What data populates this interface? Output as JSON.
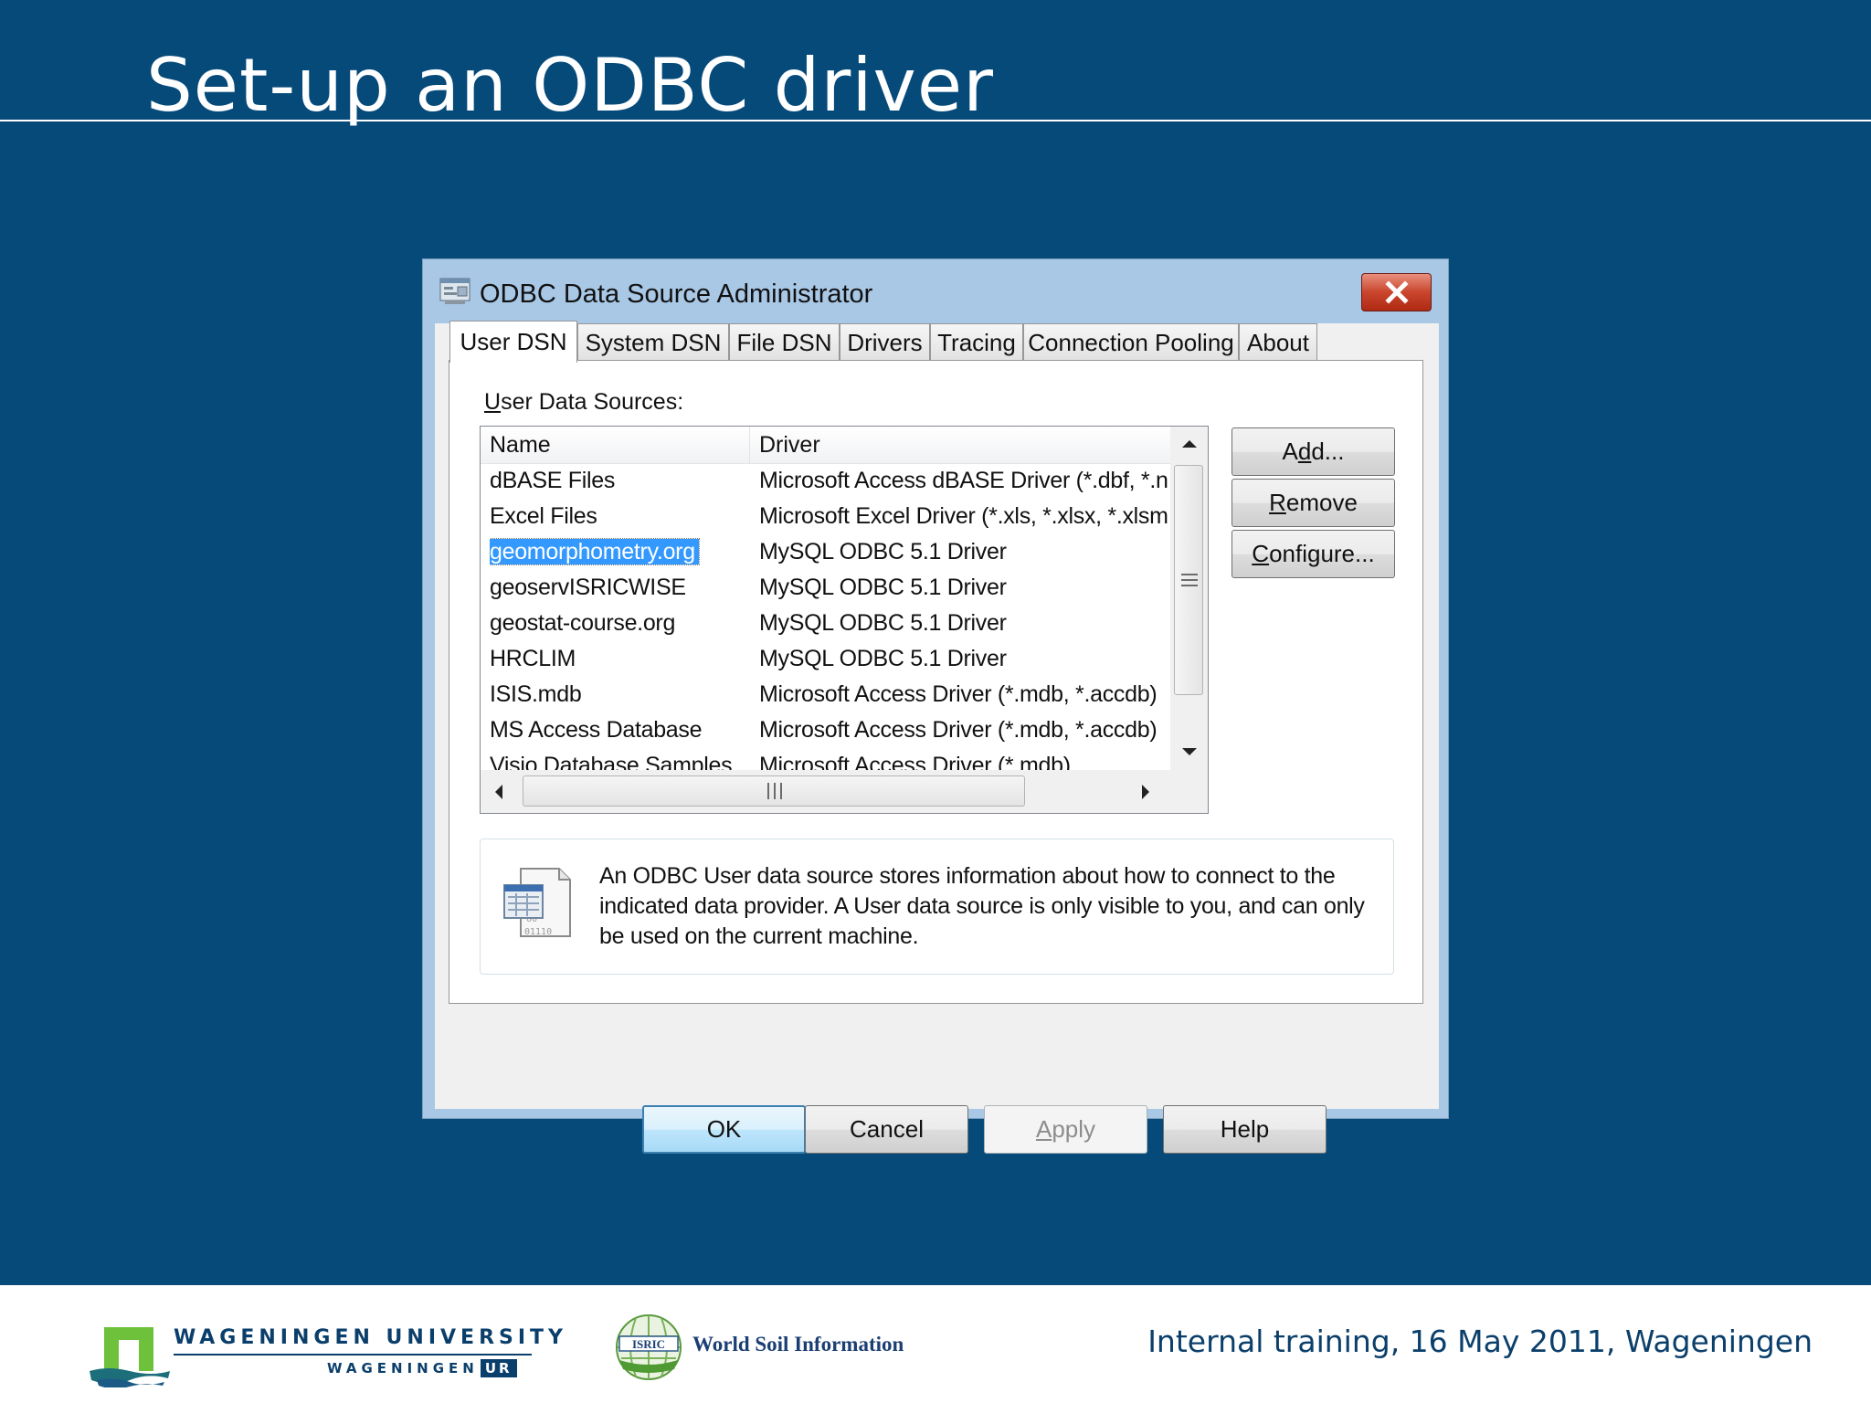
{
  "slide": {
    "title": "Set-up an ODBC driver"
  },
  "dialog": {
    "title": "ODBC Data Source Administrator",
    "tabs": [
      {
        "label": "User DSN",
        "active": true
      },
      {
        "label": "System DSN"
      },
      {
        "label": "File DSN"
      },
      {
        "label": "Drivers"
      },
      {
        "label": "Tracing"
      },
      {
        "label": "Connection Pooling"
      },
      {
        "label": "About"
      }
    ],
    "section_label_prefix": "U",
    "section_label_rest": "ser Data Sources:",
    "columns": {
      "name": "Name",
      "driver": "Driver"
    },
    "rows": [
      {
        "name": "dBASE Files",
        "driver": "Microsoft Access dBASE Driver (*.dbf, *.ndx, *.mdx)"
      },
      {
        "name": "Excel Files",
        "driver": "Microsoft Excel Driver (*.xls, *.xlsx, *.xlsm, *.xlsb)"
      },
      {
        "name": "geomorphometry.org",
        "driver": "MySQL ODBC 5.1 Driver",
        "selected": true
      },
      {
        "name": "geoservISRICWISE",
        "driver": "MySQL ODBC 5.1 Driver"
      },
      {
        "name": "geostat-course.org",
        "driver": "MySQL ODBC 5.1 Driver"
      },
      {
        "name": "HRCLIM",
        "driver": "MySQL ODBC 5.1 Driver"
      },
      {
        "name": "ISIS.mdb",
        "driver": "Microsoft Access Driver (*.mdb, *.accdb)"
      },
      {
        "name": "MS Access Database",
        "driver": "Microsoft Access Driver (*.mdb, *.accdb)"
      },
      {
        "name": "Visio Database Samples",
        "driver": "Microsoft Access Driver (*.mdb)"
      }
    ],
    "side_buttons": {
      "add_pre": "A",
      "add_ul": "d",
      "add_post": "d...",
      "remove_ul": "R",
      "remove_post": "emove",
      "configure_ul": "C",
      "configure_post": "onfigure..."
    },
    "info_text": "An ODBC User data source stores information about how to connect to the indicated data provider.   A User data source is only visible to you, and can only be used on the current machine.",
    "info_icon_caption": "01110",
    "bottom_buttons": {
      "ok": "OK",
      "cancel": "Cancel",
      "apply_ul": "A",
      "apply_post": "pply",
      "help": "Help"
    }
  },
  "footer": {
    "wur_name": "WAGENINGEN UNIVERSITY",
    "wur_sub": "WAGENINGEN",
    "wur_ur": "UR",
    "isric_logo_text": "ISRIC",
    "isric_text": "World Soil Information",
    "info": "Internal training, 16 May 2011, Wageningen"
  },
  "colors": {
    "slide_background": "#064a7a",
    "dialog_frame": "#a9c8e6",
    "selection": "#3399ff",
    "close_button": "#c9452c"
  }
}
